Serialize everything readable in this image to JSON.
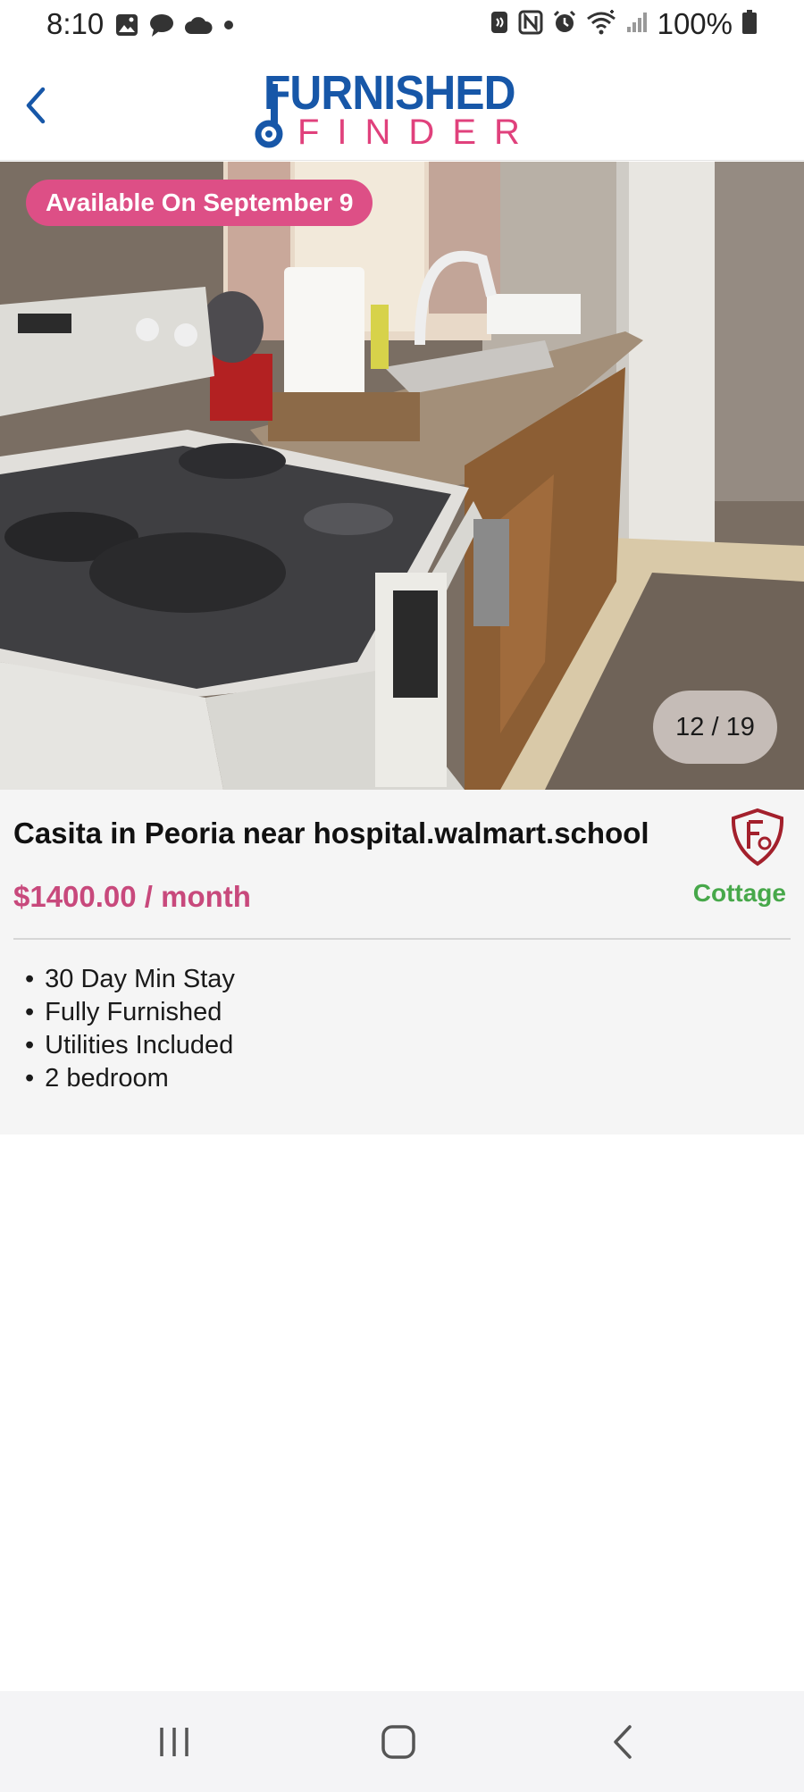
{
  "status_bar": {
    "time": "8:10",
    "battery": "100%",
    "left_icons": [
      "gallery-icon",
      "chat-icon",
      "cloud-icon",
      "dot-icon"
    ],
    "right_icons": [
      "nfc-card-icon",
      "nfc-icon",
      "alarm-icon",
      "wifi-icon",
      "signal-icon",
      "battery-icon"
    ]
  },
  "header": {
    "logo_top": "FURNISHED",
    "logo_bottom": "FINDER",
    "brand_colors": {
      "blue": "#1757a8",
      "pink": "#e0417c"
    }
  },
  "photo": {
    "badge": "Available On September 9",
    "counter": "12 / 19"
  },
  "listing": {
    "title": "Casita in Peoria near hospital.walmart.school",
    "price": "$1400.00 / month",
    "type": "Cottage",
    "features": [
      {
        "bullet": "•",
        "text": "30 Day Min Stay"
      },
      {
        "bullet": "•",
        "text": "Fully Furnished"
      },
      {
        "bullet": "•",
        "text": "Utilities Included"
      },
      {
        "bullet": "•",
        "text": "2 bedroom"
      }
    ],
    "colors": {
      "price": "#c8497c",
      "type": "#47a84a",
      "shield": "#a3202c"
    }
  },
  "nav_bar": {
    "buttons": [
      "recent-apps-icon",
      "home-icon",
      "back-icon"
    ]
  }
}
